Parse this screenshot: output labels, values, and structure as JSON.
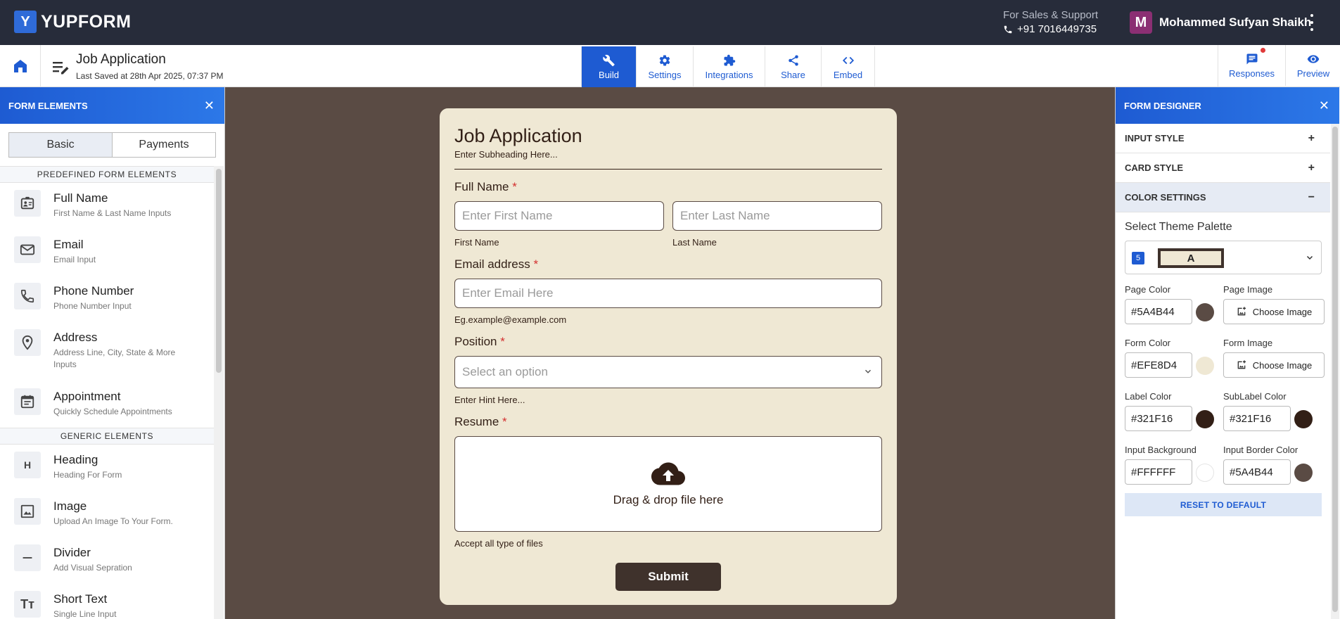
{
  "app": {
    "logo_text": "YUPFORM"
  },
  "support": {
    "label": "For Sales & Support",
    "phone": "+91 7016449735"
  },
  "user": {
    "initial": "M",
    "name": "Mohammed Sufyan Shaikh"
  },
  "form_header": {
    "title": "Job Application",
    "saved": "Last Saved at 28th Apr 2025, 07:37 PM"
  },
  "nav": {
    "tabs": [
      {
        "label": "Build",
        "icon": "wrench-icon"
      },
      {
        "label": "Settings",
        "icon": "gear-icon"
      },
      {
        "label": "Integrations",
        "icon": "puzzle-icon"
      },
      {
        "label": "Share",
        "icon": "share-icon"
      },
      {
        "label": "Embed",
        "icon": "code-icon"
      }
    ],
    "right": [
      {
        "label": "Responses",
        "icon": "chat-icon"
      },
      {
        "label": "Preview",
        "icon": "eye-icon"
      }
    ]
  },
  "left_panel": {
    "title": "FORM ELEMENTS",
    "segments": [
      "Basic",
      "Payments"
    ],
    "predefined_title": "PREDEFINED FORM ELEMENTS",
    "predefined": [
      {
        "name": "Full Name",
        "sub": "First Name & Last Name Inputs",
        "icon": "id-card-icon"
      },
      {
        "name": "Email",
        "sub": "Email Input",
        "icon": "mail-icon"
      },
      {
        "name": "Phone Number",
        "sub": "Phone Number Input",
        "icon": "phone-icon"
      },
      {
        "name": "Address",
        "sub": "Address Line, City, State & More Inputs",
        "icon": "location-icon"
      },
      {
        "name": "Appointment",
        "sub": "Quickly Schedule Appointments",
        "icon": "calendar-icon"
      }
    ],
    "generic_title": "GENERIC ELEMENTS",
    "generic": [
      {
        "name": "Heading",
        "sub": "Heading For Form",
        "icon": "heading-icon",
        "glyph": "H"
      },
      {
        "name": "Image",
        "sub": "Upload An Image To Your Form.",
        "icon": "image-icon"
      },
      {
        "name": "Divider",
        "sub": "Add Visual Sepration",
        "icon": "divider-icon"
      },
      {
        "name": "Short Text",
        "sub": "Single Line Input",
        "icon": "text-icon",
        "glyph": "Tт"
      }
    ]
  },
  "form": {
    "title": "Job Application",
    "subheading": "Enter Subheading Here...",
    "full_name_label": "Full Name",
    "first_placeholder": "Enter First Name",
    "last_placeholder": "Enter Last Name",
    "first_hint": "First Name",
    "last_hint": "Last Name",
    "email_label": "Email address",
    "email_placeholder": "Enter Email Here",
    "email_hint": "Eg.example@example.com",
    "position_label": "Position",
    "position_placeholder": "Select an option",
    "position_hint": "Enter Hint Here...",
    "resume_label": "Resume",
    "dropzone_text": "Drag & drop file here",
    "resume_hint": "Accept all type of files",
    "submit_label": "Submit",
    "required_mark": "*"
  },
  "right_panel": {
    "title": "FORM DESIGNER",
    "accordions": [
      {
        "label": "INPUT STYLE",
        "sign": "+"
      },
      {
        "label": "CARD STYLE",
        "sign": "+"
      },
      {
        "label": "COLOR SETTINGS",
        "sign": "−"
      }
    ],
    "palette_label": "Select Theme Palette",
    "palette_badge": "5",
    "palette_swatch": "A",
    "page_color_label": "Page Color",
    "page_color": "#5A4B44",
    "page_image_label": "Page Image",
    "form_color_label": "Form Color",
    "form_color": "#EFE8D4",
    "form_image_label": "Form Image",
    "choose_image": "Choose Image",
    "label_color_label": "Label Color",
    "label_color": "#321F16",
    "sublabel_color_label": "SubLabel Color",
    "sublabel_color": "#321F16",
    "input_bg_label": "Input Background",
    "input_bg": "#FFFFFF",
    "input_border_label": "Input Border Color",
    "input_border": "#5A4B44",
    "reset_label": "RESET TO DEFAULT"
  }
}
